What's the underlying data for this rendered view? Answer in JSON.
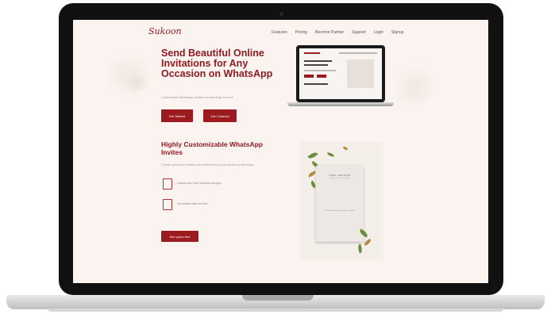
{
  "header": {
    "logo_text": "Sukoon",
    "nav": [
      "Features",
      "Pricing",
      "Become Partner",
      "Support",
      "Login",
      "Signup"
    ]
  },
  "hero": {
    "title": "Send Beautiful Online Invitations for Any Occasion on WhatsApp",
    "subtitle": "Customized WhatsApp invites for weddings & more",
    "buttons": {
      "get_started": "Get Started",
      "join": "Join Channel"
    }
  },
  "section": {
    "title": "Highly Customizable WhatsApp Invites",
    "description": "Create a personal invitation card and send it to your guests on WhatsApp",
    "features": [
      "Upload your own invitation designs",
      "Get started with our files"
    ],
    "cta": "See yours free"
  },
  "card": {
    "heading": "SAVE THE DATE",
    "subheading": "Together with their families",
    "body": "Request the pleasure of your company"
  },
  "colors": {
    "brand": "#8e1c21",
    "button": "#9c1b1f",
    "screen_bg": "#fbf3ef"
  }
}
